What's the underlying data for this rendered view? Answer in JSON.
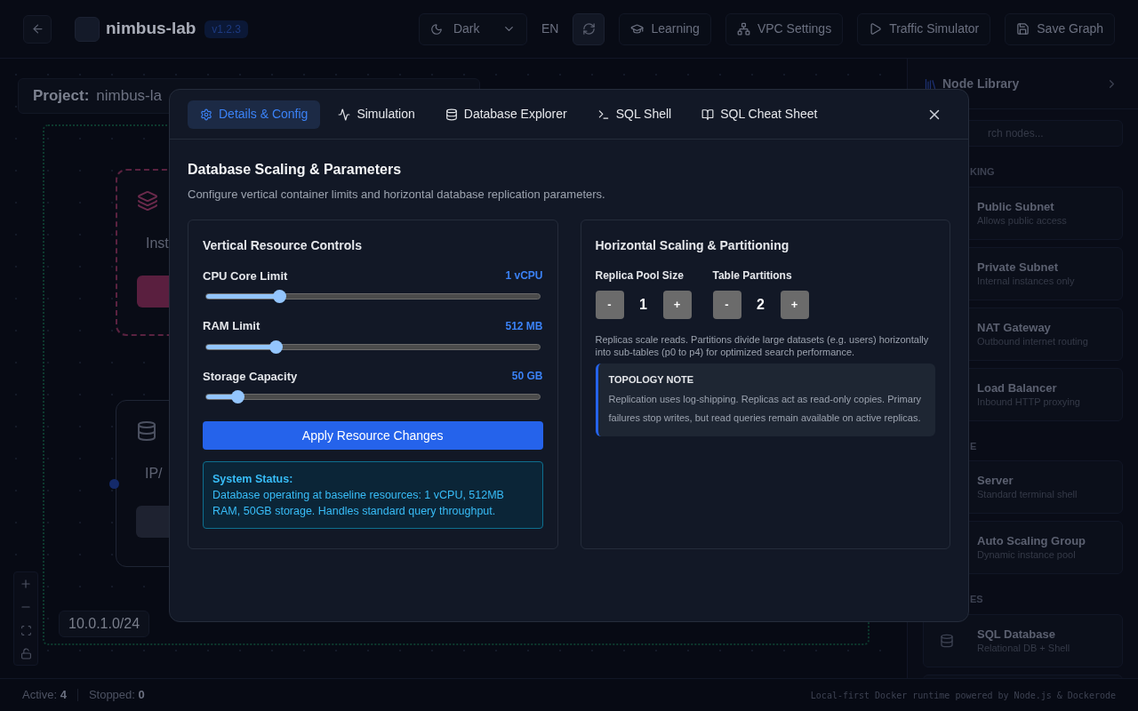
{
  "header": {
    "app_name": "nimbus-lab",
    "version": "v1.2.3",
    "theme": "Dark",
    "language": "EN",
    "actions": [
      {
        "kind": "learn",
        "label": "Learning"
      },
      {
        "kind": "vpc",
        "label": "VPC Settings"
      },
      {
        "kind": "traffic",
        "label": "Traffic Simulator"
      },
      {
        "kind": "save",
        "label": "Save Graph"
      }
    ]
  },
  "canvas": {
    "project_label": "Project:",
    "project_name": "nimbus-la",
    "subnet_cidr": "10.0.1.0/24",
    "nodes": [
      {
        "kind": "scaling",
        "detail": "Inst"
      },
      {
        "kind": "database",
        "detail": "IP/"
      }
    ]
  },
  "sidebar": {
    "title": "Node Library",
    "search_placeholder": "rch nodes...",
    "sections": [
      {
        "label": "KING",
        "items": [
          {
            "name": "Public Subnet",
            "description": "Allows public access"
          },
          {
            "name": "Private Subnet",
            "description": "Internal instances only"
          },
          {
            "name": "NAT Gateway",
            "description": "Outbound internet routing"
          },
          {
            "name": "Load Balancer",
            "description": "Inbound HTTP proxying"
          }
        ]
      },
      {
        "label": "E",
        "items": [
          {
            "name": "Server",
            "description": "Standard terminal shell"
          },
          {
            "name": "Auto Scaling Group",
            "description": "Dynamic instance pool"
          }
        ]
      },
      {
        "label": "ES",
        "items": [
          {
            "name": "SQL Database",
            "description": "Relational DB + Shell"
          }
        ]
      }
    ]
  },
  "status_bar": {
    "active_label": "Active:",
    "active_count": "4",
    "stopped_label": "Stopped:",
    "stopped_count": "0",
    "footer": "Local-first Docker runtime powered by Node.js & Dockerode"
  },
  "modal": {
    "tabs": [
      {
        "kind": "config",
        "label": "Details & Config",
        "selected": true
      },
      {
        "kind": "simulation",
        "label": "Simulation",
        "selected": false
      },
      {
        "kind": "explorer",
        "label": "Database Explorer",
        "selected": false
      },
      {
        "kind": "shell",
        "label": "SQL Shell",
        "selected": false
      },
      {
        "kind": "cheatsheet",
        "label": "SQL Cheat Sheet",
        "selected": false
      }
    ],
    "title": "Database Scaling & Parameters",
    "subtitle": "Configure vertical container limits and horizontal database replication parameters.",
    "vertical": {
      "title": "Vertical Resource Controls",
      "sliders": [
        {
          "label": "CPU Core Limit",
          "reading": "1 vCPU",
          "level": 0.22
        },
        {
          "label": "RAM Limit",
          "reading": "512 MB",
          "level": 0.21
        },
        {
          "label": "Storage Capacity",
          "reading": "50 GB",
          "level": 0.095
        }
      ],
      "apply_button": "Apply Resource Changes",
      "status_title": "System Status:",
      "status_text": "Database operating at baseline resources: 1 vCPU, 512MB RAM, 50GB storage. Handles standard query throughput."
    },
    "horizontal": {
      "title": "Horizontal Scaling & Partitioning",
      "steppers": [
        {
          "label": "Replica Pool Size",
          "value": "1",
          "minus": "-",
          "plus": "+"
        },
        {
          "label": "Table Partitions",
          "value": "2",
          "minus": "-",
          "plus": "+"
        }
      ],
      "description": "Replicas scale reads. Partitions divide large datasets (e.g. users) horizontally into sub-tables (p0 to p4) for optimized search performance.",
      "note_title": "TOPOLOGY NOTE",
      "note_text": "Replication uses log-shipping. Replicas act as read-only copies. Primary failures stop writes, but read queries remain available on active replicas."
    }
  }
}
